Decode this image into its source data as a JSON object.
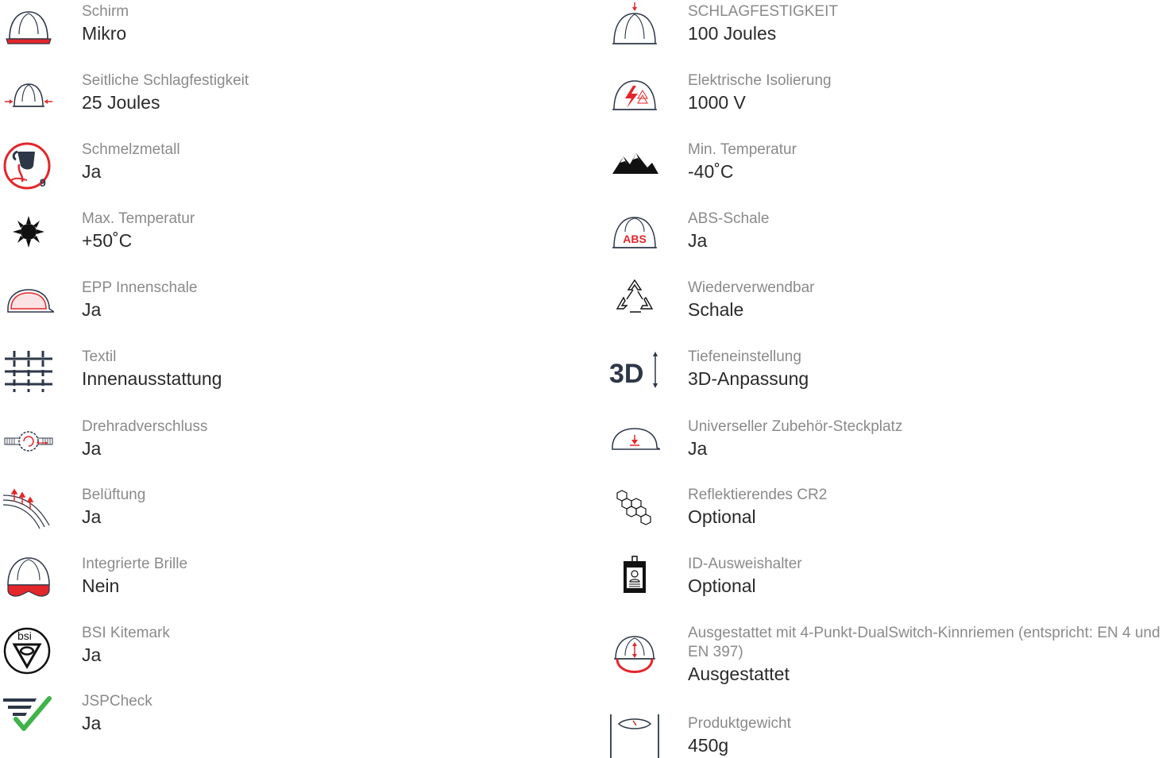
{
  "colors": {
    "icon_dark": "#2d3748",
    "accent_red": "#e3262b",
    "check_green": "#3fb34a",
    "label_gray": "#8a8a8a",
    "value_dark": "#2a2a2a"
  },
  "left_column": [
    {
      "icon": "helmet-visor-icon",
      "label": "Schirm",
      "value": "Mikro"
    },
    {
      "icon": "side-impact-icon",
      "label": "Seitliche Schlagfestigkeit",
      "value": "25 Joules"
    },
    {
      "icon": "molten-metal-icon",
      "label": "Schmelzmetall",
      "value": "Ja",
      "badge": "9"
    },
    {
      "icon": "sun-icon",
      "label": "Max. Temperatur",
      "value": "+50˚C"
    },
    {
      "icon": "epp-liner-icon",
      "label": "EPP Innenschale",
      "value": "Ja"
    },
    {
      "icon": "textile-grid-icon",
      "label": "Textil",
      "value": "Innenausstattung"
    },
    {
      "icon": "wheel-ratchet-icon",
      "label": "Drehradverschluss",
      "value": "Ja"
    },
    {
      "icon": "ventilation-icon",
      "label": "Belüftung",
      "value": "Ja"
    },
    {
      "icon": "integrated-goggles-icon",
      "label": "Integrierte Brille",
      "value": "Nein"
    },
    {
      "icon": "bsi-kitemark-icon",
      "label": "BSI Kitemark",
      "value": "Ja",
      "badge": "bsi"
    },
    {
      "icon": "jspcheck-icon",
      "label": "JSPCheck",
      "value": "Ja"
    }
  ],
  "right_column": [
    {
      "icon": "top-impact-icon",
      "label": "SCHLAGFESTIGKEIT",
      "value": "100 Joules"
    },
    {
      "icon": "electrical-insulation-icon",
      "label": "Elektrische Isolierung",
      "value": "1000 V"
    },
    {
      "icon": "mountains-icon",
      "label": "Min. Temperatur",
      "value": "-40˚C"
    },
    {
      "icon": "abs-shell-icon",
      "label": "ABS-Schale",
      "value": "Ja",
      "badge": "ABS"
    },
    {
      "icon": "recycle-icon",
      "label": "Wiederverwendbar",
      "value": "Schale"
    },
    {
      "icon": "3d-adjust-icon",
      "label": "Tiefeneinstellung",
      "value": "3D-Anpassung",
      "badge": "3D"
    },
    {
      "icon": "accessory-slot-icon",
      "label": "Universeller Zubehör-Steckplatz",
      "value": "Ja"
    },
    {
      "icon": "reflective-honeycomb-icon",
      "label": "Reflektierendes CR2",
      "value": "Optional"
    },
    {
      "icon": "id-badge-icon",
      "label": "ID-Ausweishalter",
      "value": "Optional"
    },
    {
      "icon": "chinstrap-icon",
      "label": "Ausgestattet mit 4-Punkt-DualSwitch-Kinnriemen (entspricht: EN 4 und EN 397)",
      "value": "Ausgestattet"
    },
    {
      "icon": "weight-scale-icon",
      "label": "Produktgewicht",
      "value": "450g"
    }
  ]
}
